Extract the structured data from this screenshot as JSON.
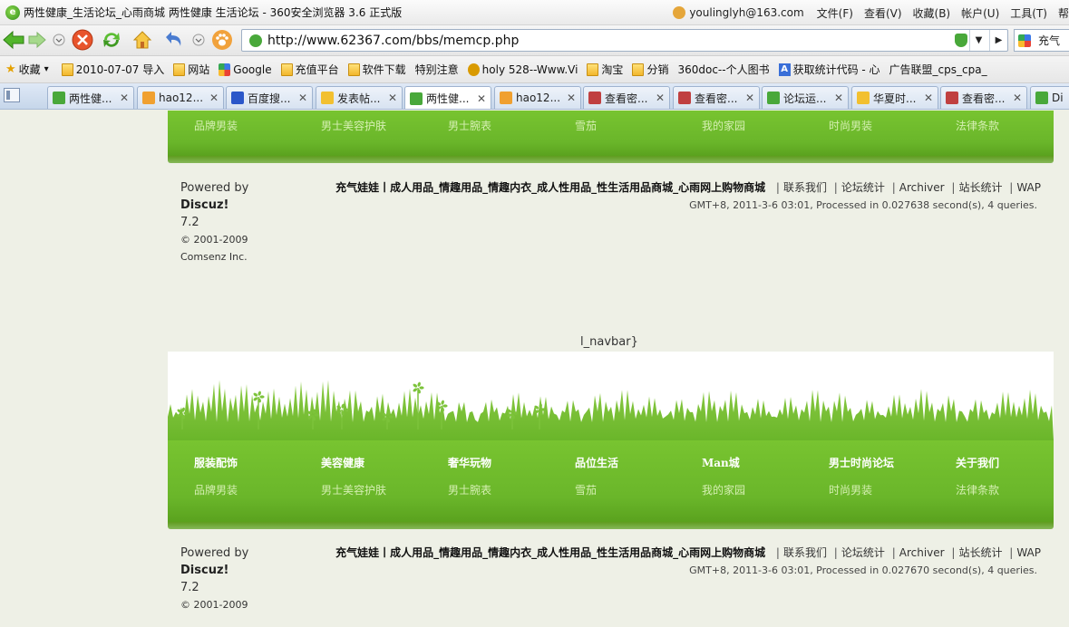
{
  "titlebar": {
    "title": "两性健康_生活论坛_心雨商城 两性健康 生活论坛 - 360安全浏览器 3.6 正式版",
    "account": "youlinglyh@163.com",
    "menu": [
      "文件(F)",
      "查看(V)",
      "收藏(B)",
      "帐户(U)",
      "工具(T)",
      "帮"
    ]
  },
  "address": {
    "url": "http://www.62367.com/bbs/memcp.php",
    "search_text": "充气"
  },
  "bookmarks": [
    {
      "label": "收藏",
      "icon": "star-icon"
    },
    {
      "label": "2010-07-07 导入",
      "icon": "folder-icon"
    },
    {
      "label": "网站",
      "icon": "folder-icon"
    },
    {
      "label": "Google",
      "icon": "google-icon"
    },
    {
      "label": "充值平台",
      "icon": "folder-icon"
    },
    {
      "label": "软件下载",
      "icon": "folder-icon"
    },
    {
      "label": "特别注意",
      "icon": "page-icon"
    },
    {
      "label": "holy 528--Www.Vi",
      "icon": "holy-icon"
    },
    {
      "label": "淘宝",
      "icon": "folder-icon"
    },
    {
      "label": "分销",
      "icon": "folder-icon"
    },
    {
      "label": "360doc--个人图书",
      "icon": "page-icon"
    },
    {
      "label": "获取统计代码 - 心",
      "icon": "a-icon"
    },
    {
      "label": "广告联盟_cps_cpa_",
      "icon": "page-icon"
    }
  ],
  "tabs": [
    {
      "label": "两性健...",
      "color": "#49a83a",
      "active": false
    },
    {
      "label": "hao12...",
      "color": "#f0a030",
      "active": false
    },
    {
      "label": "百度搜...",
      "color": "#2b57c9",
      "active": false
    },
    {
      "label": "发表帖...",
      "color": "#f2c030",
      "active": false
    },
    {
      "label": "两性健...",
      "color": "#49a83a",
      "active": true
    },
    {
      "label": "hao12...",
      "color": "#f0a030",
      "active": false
    },
    {
      "label": "查看密...",
      "color": "#c04040",
      "active": false
    },
    {
      "label": "查看密...",
      "color": "#c04040",
      "active": false
    },
    {
      "label": "论坛运...",
      "color": "#49a83a",
      "active": false
    },
    {
      "label": "华夏时...",
      "color": "#f2c030",
      "active": false
    },
    {
      "label": "查看密...",
      "color": "#c04040",
      "active": false
    },
    {
      "label": "Di",
      "color": "#49a83a",
      "active": false
    }
  ],
  "site_nav": {
    "heads": [
      "服装配饰",
      "美容健康",
      "奢华玩物",
      "品位生活",
      "Man城",
      "男士时尚论坛",
      "关于我们"
    ],
    "subs": [
      "品牌男装",
      "男士美容护肤",
      "男士腕表",
      "雪茄",
      "我的家园",
      "时尚男装",
      "法律条款"
    ]
  },
  "footer": {
    "powered_by": "Powered by",
    "product": "Discuz!",
    "version": "7.2",
    "copyright": "© 2001-2009",
    "company": "Comsenz Inc.",
    "site_name": "充气娃娃丨成人用品_情趣用品_情趣内衣_成人性用品_性生活用品商城_心雨网上购物商城",
    "links": [
      "联系我们",
      "论坛统计",
      "Archiver",
      "站长统计",
      "WAP"
    ],
    "gmt_top": "GMT+8, 2011-3-6 03:01, Processed in 0.027638 second(s), 4 queries.",
    "gmt_bottom": "GMT+8, 2011-3-6 03:01, Processed in 0.027670 second(s), 4 queries."
  },
  "template_leak": "l_navbar}"
}
